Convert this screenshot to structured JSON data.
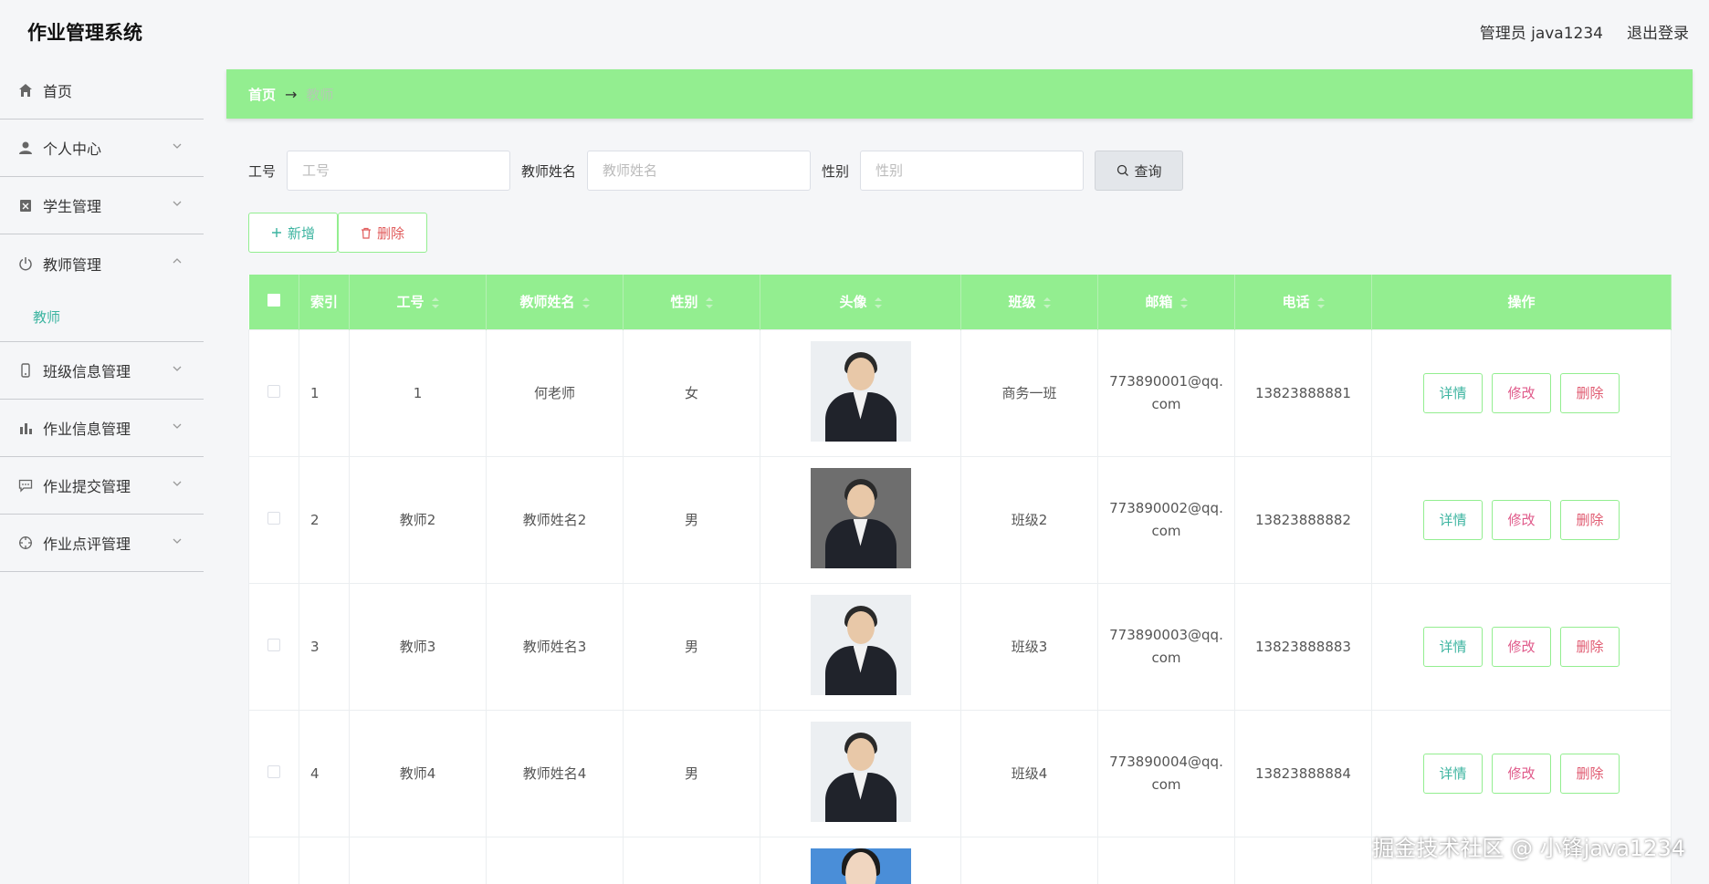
{
  "app": {
    "title": "作业管理系统"
  },
  "header": {
    "user": "管理员 java1234",
    "logout": "退出登录"
  },
  "sidebar": {
    "items": [
      {
        "label": "首页",
        "icon": "home-icon"
      },
      {
        "label": "个人中心",
        "icon": "user-icon"
      },
      {
        "label": "学生管理",
        "icon": "clipboard-icon"
      },
      {
        "label": "教师管理",
        "icon": "power-icon",
        "expanded": true,
        "sub": [
          "教师"
        ]
      },
      {
        "label": "班级信息管理",
        "icon": "phone-icon"
      },
      {
        "label": "作业信息管理",
        "icon": "bar-chart-icon"
      },
      {
        "label": "作业提交管理",
        "icon": "chat-icon"
      },
      {
        "label": "作业点评管理",
        "icon": "target-icon"
      }
    ]
  },
  "breadcrumb": {
    "home": "首页",
    "arrow": "→",
    "current": "教师"
  },
  "search": {
    "id_label": "工号",
    "id_placeholder": "工号",
    "name_label": "教师姓名",
    "name_placeholder": "教师姓名",
    "gender_label": "性别",
    "gender_placeholder": "性别",
    "query": "查询"
  },
  "actions": {
    "add": "新增",
    "delete": "删除"
  },
  "table": {
    "headers": [
      "索引",
      "工号",
      "教师姓名",
      "性别",
      "头像",
      "班级",
      "邮箱",
      "电话",
      "操作"
    ],
    "rows": [
      {
        "index": "1",
        "id": "1",
        "name": "何老师",
        "gender": "女",
        "class": "商务一班",
        "email": "773890001@qq.com",
        "phone": "13823888881"
      },
      {
        "index": "2",
        "id": "教师2",
        "name": "教师姓名2",
        "gender": "男",
        "class": "班级2",
        "email": "773890002@qq.com",
        "phone": "13823888882"
      },
      {
        "index": "3",
        "id": "教师3",
        "name": "教师姓名3",
        "gender": "男",
        "class": "班级3",
        "email": "773890003@qq.com",
        "phone": "13823888883"
      },
      {
        "index": "4",
        "id": "教师4",
        "name": "教师姓名4",
        "gender": "男",
        "class": "班级4",
        "email": "773890004@qq.com",
        "phone": "13823888884"
      }
    ],
    "row_actions": {
      "detail": "详情",
      "edit": "修改",
      "delete": "删除"
    }
  },
  "colors": {
    "accent": "#93ee90",
    "teal": "#3cb4a0",
    "danger": "#e05a70"
  },
  "watermark": "掘金技术社区 @ 小锋java1234"
}
